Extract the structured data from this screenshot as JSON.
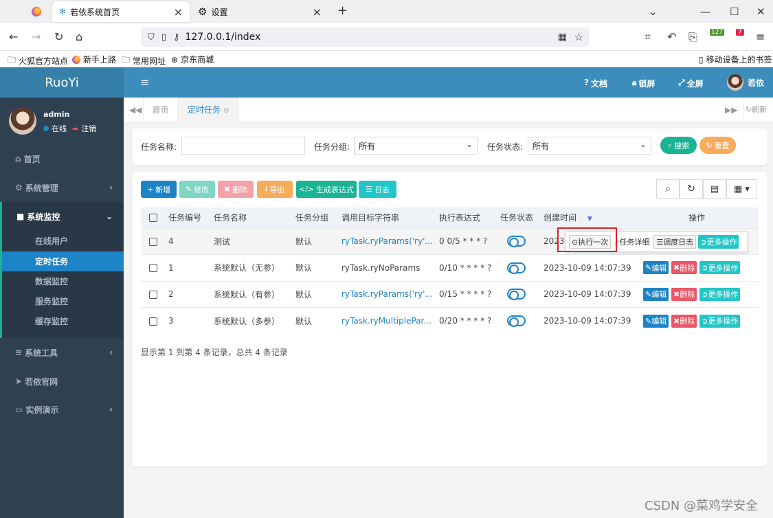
{
  "browser": {
    "tabs": [
      {
        "title": "若依系统首页",
        "active": true
      },
      {
        "title": "设置",
        "active": false
      }
    ],
    "url": "127.0.0.1/index",
    "badges": {
      "ext1": "127",
      "ext2": "7"
    },
    "bookmarks": [
      "火狐官方站点",
      "新手上路",
      "常用网址",
      "京东商城"
    ],
    "mobile_bookmarks": "移动设备上的书签"
  },
  "app": {
    "logo": "RuoYi",
    "topbar": {
      "docs": "文档",
      "lock": "锁屏",
      "fullscreen": "全屏",
      "user": "若依"
    },
    "user": {
      "name": "admin",
      "status": "在线",
      "logout": "注销"
    },
    "menu": [
      {
        "label": "首页",
        "icon": "home-icon"
      },
      {
        "label": "系统管理",
        "icon": "gear-icon"
      },
      {
        "label": "系统监控",
        "icon": "video-icon"
      },
      {
        "label": "系统工具",
        "icon": "list-icon"
      },
      {
        "label": "若依官网",
        "icon": "send-icon"
      },
      {
        "label": "实例演示",
        "icon": "desktop-icon"
      }
    ],
    "submenu": [
      "在线用户",
      "定时任务",
      "数据监控",
      "服务监控",
      "缓存监控"
    ],
    "page_tabs": {
      "home": "首页",
      "current": "定时任务",
      "refresh": "刷新"
    }
  },
  "search": {
    "name_label": "任务名称:",
    "name_value": "",
    "group_label": "任务分组:",
    "group_value": "所有",
    "status_label": "任务状态:",
    "status_value": "所有",
    "search_btn": "搜索",
    "reset_btn": "重置"
  },
  "toolbar": {
    "add": "新增",
    "edit": "修改",
    "delete": "删除",
    "export": "导出",
    "cron": "生成表达式",
    "log": "日志"
  },
  "table": {
    "headers": [
      "任务编号",
      "任务名称",
      "任务分组",
      "调用目标字符串",
      "执行表达式",
      "任务状态",
      "创建时间",
      "操作"
    ],
    "rows": [
      {
        "id": "4",
        "name": "测试",
        "group": "默认",
        "target": "ryTask.ryParams('ry'...",
        "cron": "0 0/5 * * * ?",
        "time": "2023"
      },
      {
        "id": "1",
        "name": "系统默认（无参）",
        "group": "默认",
        "target": "ryTask.ryNoParams",
        "cron": "0/10 * * * * ?",
        "time": "2023-10-09 14:07:39"
      },
      {
        "id": "2",
        "name": "系统默认（有参）",
        "group": "默认",
        "target": "ryTask.ryParams('ry'...",
        "cron": "0/15 * * * * ?",
        "time": "2023-10-09 14:07:39"
      },
      {
        "id": "3",
        "name": "系统默认（多参）",
        "group": "默认",
        "target": "ryTask.ryMultiplePar...",
        "cron": "0/20 * * * * ?",
        "time": "2023-10-09 14:07:39"
      }
    ],
    "actions": {
      "edit": "编辑",
      "delete": "删除",
      "more": "更多操作"
    },
    "popup": {
      "run_once": "执行一次",
      "detail": "任务详细",
      "log": "调度日志"
    },
    "footer": "显示第 1 到第 4 条记录，总共 4 条记录"
  },
  "watermark": "CSDN @菜鸡学安全",
  "colors": {
    "primary": "#1ab394",
    "info": "#23c6c8",
    "danger": "#ed5565",
    "warning": "#f8ac59",
    "blue": "#1c84c6",
    "sidebar": "#2f4050"
  }
}
